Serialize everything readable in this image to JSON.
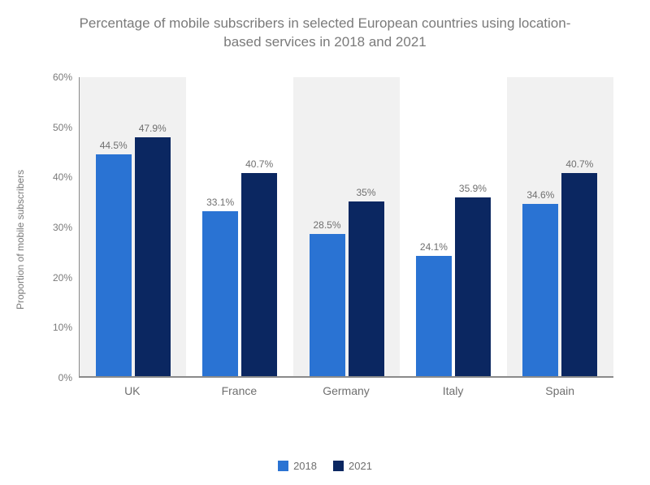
{
  "chart_data": {
    "type": "bar",
    "title": "Percentage of mobile subscribers in selected European countries using location-based services in 2018 and 2021",
    "ylabel": "Proportion of mobile subscribers",
    "xlabel": "",
    "ylim": [
      0,
      60
    ],
    "yticks": [
      0,
      10,
      20,
      30,
      40,
      50,
      60
    ],
    "ytick_labels": [
      "0%",
      "10%",
      "20%",
      "30%",
      "40%",
      "50%",
      "60%"
    ],
    "categories": [
      "UK",
      "France",
      "Germany",
      "Italy",
      "Spain"
    ],
    "series": [
      {
        "name": "2018",
        "values": [
          44.5,
          33.1,
          28.5,
          24.1,
          34.6
        ],
        "labels": [
          "44.5%",
          "33.1%",
          "28.5%",
          "24.1%",
          "34.6%"
        ],
        "color": "#2a73d3"
      },
      {
        "name": "2021",
        "values": [
          47.9,
          40.7,
          35.0,
          35.9,
          40.7
        ],
        "labels": [
          "47.9%",
          "40.7%",
          "35%",
          "35.9%",
          "40.7%"
        ],
        "color": "#0b2761"
      }
    ],
    "legend_position": "bottom",
    "grid": false
  }
}
